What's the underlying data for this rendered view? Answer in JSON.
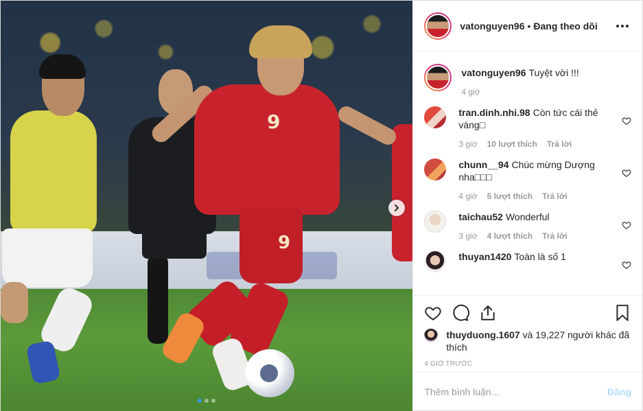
{
  "header": {
    "username": "vatonguyen96",
    "separator": "•",
    "follow_status": "Đang theo dõi"
  },
  "photo": {
    "jersey_number_chest": "9",
    "jersey_number_shorts": "9",
    "carousel": {
      "total": 3,
      "active_index": 0
    }
  },
  "caption": {
    "username": "vatonguyen96",
    "text": "Tuyệt vời !!!",
    "time": "4 giờ"
  },
  "comments": [
    {
      "username": "tran.dinh.nhi.98",
      "text": "Còn tức cái thẻ vàng□",
      "time": "3 giờ",
      "likes": "10 lượt thích",
      "reply": "Trả lời"
    },
    {
      "username": "chunn__94",
      "text": "Chúc mừng Dượng nha□□□",
      "time": "4 giờ",
      "likes": "5 lượt thích",
      "reply": "Trả lời"
    },
    {
      "username": "taichau52",
      "text": "Wonderful",
      "time": "3 giờ",
      "likes": "4 lượt thích",
      "reply": "Trả lời"
    },
    {
      "username": "thuyan1420",
      "text": "Toàn là số 1",
      "time": "",
      "likes": "",
      "reply": ""
    }
  ],
  "likes": {
    "username": "thuyduong.1607",
    "rest": "và 19,227 người khác đã thích"
  },
  "timestamp": "4 GIỜ TRƯỚC",
  "add_comment": {
    "placeholder": "Thêm bình luận...",
    "post_label": "Đăng"
  },
  "colors": {
    "accent_blue": "#3897f0",
    "post_disabled": "#b2dffc",
    "meta_gray": "#999999",
    "text": "#262626"
  }
}
